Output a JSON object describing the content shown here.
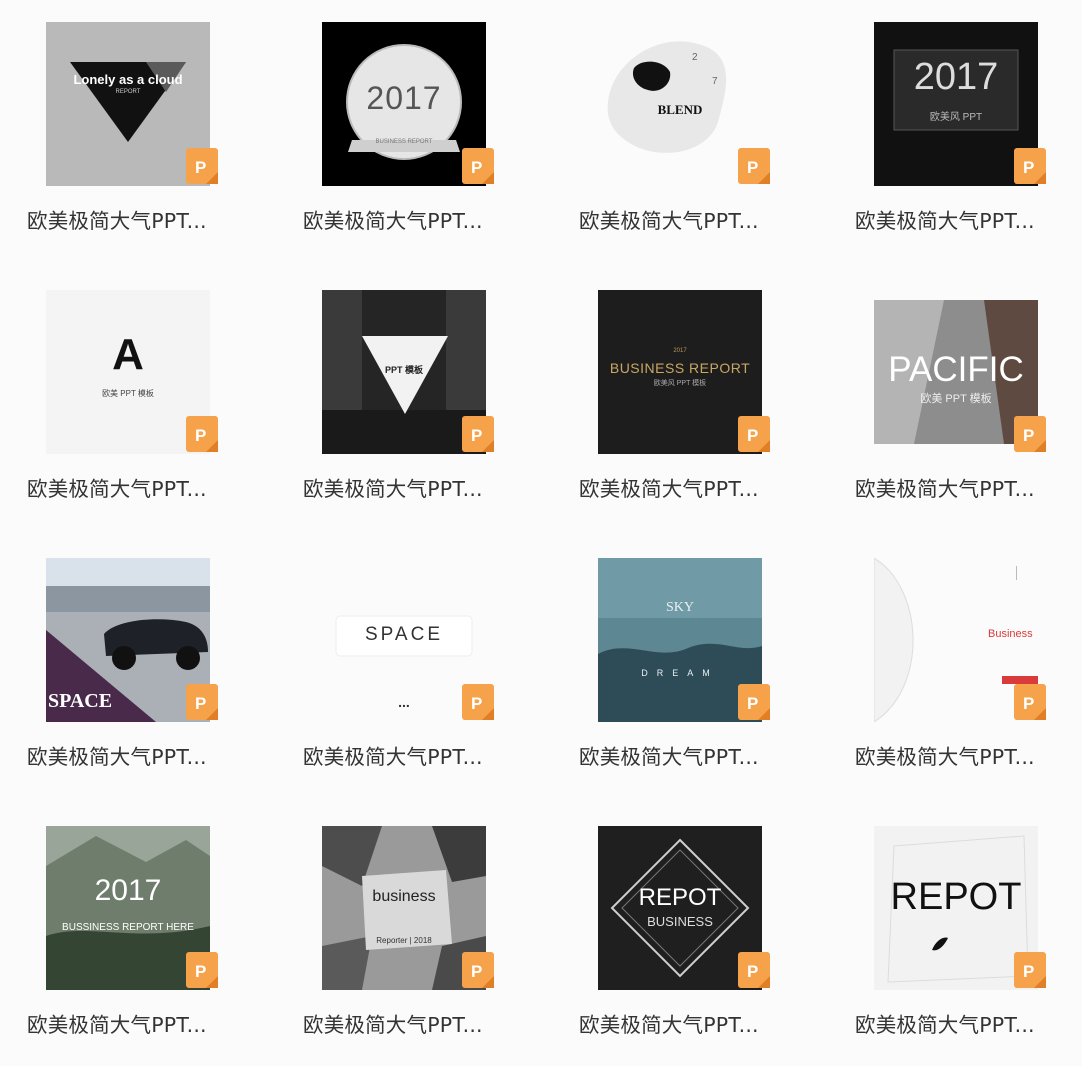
{
  "file_label": "欧美极简大气PPT...",
  "files": [
    {
      "thumb_text": [
        "Lonely as a cloud",
        "REPORT"
      ],
      "type_badge": "P"
    },
    {
      "thumb_text": [
        "2017",
        "BUSINESS REPORT"
      ],
      "type_badge": "P"
    },
    {
      "thumb_text": [
        "BLEND",
        "2",
        "7"
      ],
      "type_badge": "P"
    },
    {
      "thumb_text": [
        "2017",
        "欧美风 PPT"
      ],
      "type_badge": "P"
    },
    {
      "thumb_text": [
        "A",
        "欧美 PPT 模板"
      ],
      "type_badge": "P"
    },
    {
      "thumb_text": [
        "PPT 模板"
      ],
      "type_badge": "P"
    },
    {
      "thumb_text": [
        "2017",
        "BUSINESS REPORT",
        "欧美风 PPT 模板"
      ],
      "type_badge": "P"
    },
    {
      "thumb_text": [
        "PACIFIC",
        "欧美 PPT 模板"
      ],
      "type_badge": "P"
    },
    {
      "thumb_text": [
        "SPACE"
      ],
      "type_badge": "P"
    },
    {
      "thumb_text": [
        "SPACE",
        "..."
      ],
      "type_badge": "P"
    },
    {
      "thumb_text": [
        "SKY",
        "DREAM"
      ],
      "type_badge": "P"
    },
    {
      "thumb_text": [
        "Business"
      ],
      "type_badge": "P"
    },
    {
      "thumb_text": [
        "2017",
        "BUSSINESS REPORT HERE"
      ],
      "type_badge": "P"
    },
    {
      "thumb_text": [
        "business",
        "Reporter | 2018"
      ],
      "type_badge": "P"
    },
    {
      "thumb_text": [
        "REPOT",
        "BUSINESS"
      ],
      "type_badge": "P"
    },
    {
      "thumb_text": [
        "REPOT"
      ],
      "type_badge": "P"
    }
  ],
  "colors": {
    "badge": "#f6a24a",
    "badge_shadow": "#e07f25",
    "label": "#333333",
    "background": "#fbfbfb"
  }
}
